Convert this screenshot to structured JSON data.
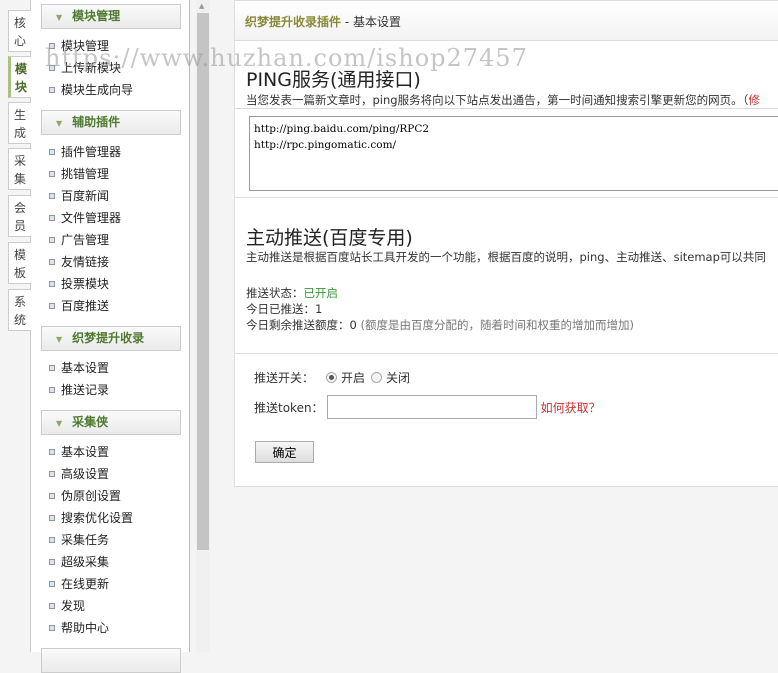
{
  "left_tabs": [
    "核心",
    "模块",
    "生成",
    "采集",
    "会员",
    "模板",
    "系统"
  ],
  "active_tab": 1,
  "sidebar": {
    "groups": [
      {
        "title": "模块管理",
        "items": [
          "模块管理",
          "上传新模块",
          "模块生成向导"
        ]
      },
      {
        "title": "辅助插件",
        "items": [
          "插件管理器",
          "挑错管理",
          "百度新闻",
          "文件管理器",
          "广告管理",
          "友情链接",
          "投票模块",
          "百度推送"
        ]
      },
      {
        "title": "织梦提升收录",
        "items": [
          "基本设置",
          "推送记录"
        ]
      },
      {
        "title": "采集侠",
        "items": [
          "基本设置",
          "高级设置",
          "伪原创设置",
          "搜索优化设置",
          "采集任务",
          "超级采集",
          "在线更新",
          "发现",
          "帮助中心"
        ]
      }
    ]
  },
  "header": {
    "plugin": "织梦提升收录插件",
    "sep": " - ",
    "page": "基本设置"
  },
  "ping": {
    "title": "PING服务(通用接口)",
    "desc": "当您发表一篇新文章时，ping服务将向以下站点发出通告，第一时间通知搜索引擎更新您的网页。（",
    "desc_more": "修",
    "urls": "http://ping.baidu.com/ping/RPC2\nhttp://rpc.pingomatic.com/"
  },
  "push": {
    "title": "主动推送(百度专用)",
    "desc": "主动推送是根据百度站长工具开发的一个功能，根据百度的说明，ping、主动推送、sitemap可以共同",
    "status_label": "推送状态：",
    "status_value": "已开启",
    "today_label": "今日已推送：",
    "today_value": "1",
    "remain_label": "今日剩余推送额度：",
    "remain_value": "0",
    "remain_note": " (额度是由百度分配的，随着时间和权重的增加而增加)"
  },
  "form": {
    "switch_label": "推送开关：",
    "on": "开启",
    "off": "关闭",
    "selected": "on",
    "token_label": "推送token：",
    "token_value": "",
    "how_link": "如何获取？",
    "submit": "确定"
  },
  "watermark": "https://www.huzhan.com/ishop27457"
}
